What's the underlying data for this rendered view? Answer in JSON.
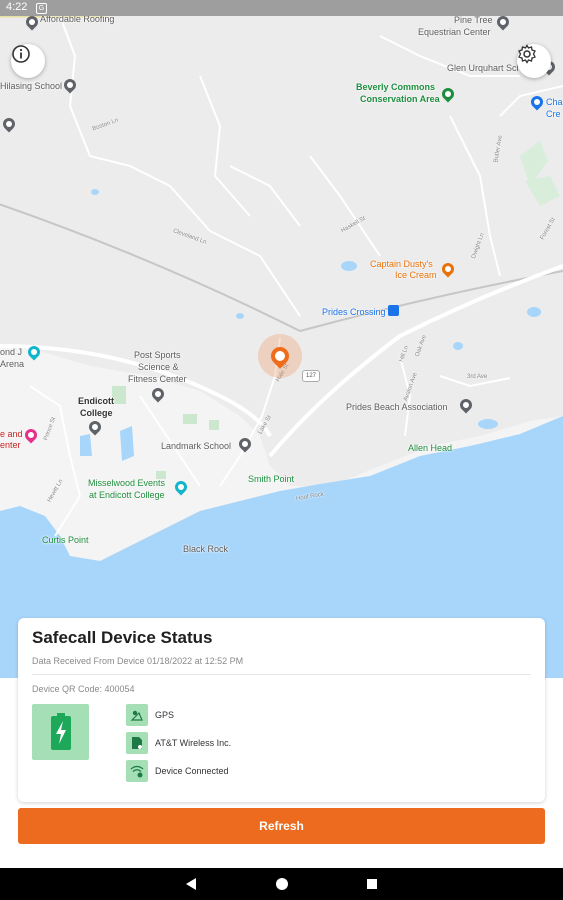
{
  "status_bar": {
    "time": "4:22",
    "notification_icon": "g-icon"
  },
  "map": {
    "labels": [
      {
        "text": "Affordable Roofing",
        "style": "normal"
      },
      {
        "text": "Pine Tree",
        "style": "normal"
      },
      {
        "text": "Equestrian Center",
        "style": "normal"
      },
      {
        "text": "Glen Urquhart School",
        "style": "normal"
      },
      {
        "text": "Beverly Commons",
        "style": "green"
      },
      {
        "text": "Conservation Area",
        "style": "green"
      },
      {
        "text": "Cha",
        "style": "blue"
      },
      {
        "text": "Cre",
        "style": "blue"
      },
      {
        "text": "Hilasing School",
        "style": "normal"
      },
      {
        "text": "Captain Dusty's",
        "style": "orange"
      },
      {
        "text": "Ice Cream",
        "style": "orange"
      },
      {
        "text": "Prides Crossing",
        "style": "blue"
      },
      {
        "text": "Post Sports",
        "style": "normal"
      },
      {
        "text": "Science &",
        "style": "normal"
      },
      {
        "text": "Fitness Center",
        "style": "normal"
      },
      {
        "text": "ond J",
        "style": "normal"
      },
      {
        "text": "Arena",
        "style": "normal"
      },
      {
        "text": "Endicott",
        "style": "bold"
      },
      {
        "text": "College",
        "style": "bold"
      },
      {
        "text": "Prides Beach Association",
        "style": "normal"
      },
      {
        "text": "e and",
        "style": "red"
      },
      {
        "text": "enter",
        "style": "red"
      },
      {
        "text": "Landmark School",
        "style": "normal"
      },
      {
        "text": "Allen Head",
        "style": "green"
      },
      {
        "text": "Smith Point",
        "style": "green"
      },
      {
        "text": "Misselwood Events",
        "style": "green"
      },
      {
        "text": "at Endicott College",
        "style": "green"
      },
      {
        "text": "Curtis Point",
        "style": "green"
      },
      {
        "text": "Black Rock",
        "style": "normal"
      }
    ],
    "roads": [
      "Boston Ln",
      "Cleveland Ln",
      "Haskell St",
      "Hill Ln",
      "Avalon Ave",
      "Oak Ave",
      "Dwight Ln",
      "Butler Ave",
      "Hale St",
      "Lake St",
      "3rd Ave",
      "Prince St",
      "Hoof Rock",
      "Hewitt Ln",
      "Forest St"
    ],
    "route_badge": "127",
    "info_button_icon": "info-icon",
    "settings_button_icon": "gear-icon",
    "device_marker_icon": "device-location-icon"
  },
  "card": {
    "title": "Safecall Device Status",
    "received": "Data Received From Device 01/18/2022 at 12:52 PM",
    "qr_code": "Device QR Code: 400054",
    "battery_icon": "battery-charging-icon",
    "statuses": [
      {
        "label": "GPS",
        "icon": "gps-icon"
      },
      {
        "label": "AT&T Wireless Inc.",
        "icon": "sim-card-icon"
      },
      {
        "label": "Device Connected",
        "icon": "wifi-connected-icon"
      }
    ]
  },
  "refresh_label": "Refresh",
  "nav": {
    "back": "back-icon",
    "home": "home-icon",
    "recents": "recents-icon"
  },
  "colors": {
    "accent": "#ec6b1e",
    "status_green": "#a5dfb5",
    "water": "#a8d6fb",
    "map_bg": "#ececec"
  }
}
